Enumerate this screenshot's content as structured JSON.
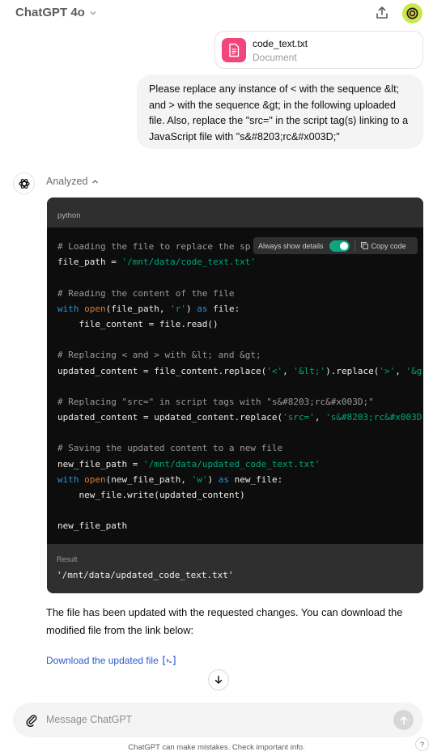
{
  "header": {
    "title": "ChatGPT 4o",
    "share_icon": "share-icon",
    "avatar_icon": "user-avatar"
  },
  "attachment": {
    "name": "code_text.txt",
    "type": "Document",
    "icon": "document-icon",
    "icon_color": "#f1457b"
  },
  "user_message": "Please replace any instance of < with the sequence &lt; and > with the sequence &gt; in the following uploaded file. Also, replace the \"src=\" in the script tag(s) linking to a JavaScript file with \"s&#8203;rc&#x003D;\"",
  "assistant": {
    "status": "Analyzed",
    "code": {
      "language": "python",
      "always_show_details": "Always show details",
      "copy_label": "Copy code",
      "line_texts": {
        "l1": "# Loading the file to replace the sp",
        "l2_str": "'/mnt/data/code_text.txt'",
        "l4": "# Reading the content of the file",
        "l7": "# Replacing < and > with &lt; and &gt;",
        "l10": "# Replacing \"src=\" in script tags with \"s&#8203;rc&#x003D;\"",
        "l13": "# Saving the updated content to a new file",
        "l14_str": "'/mnt/data/updated_code_text.txt'",
        "l17": "new_file_path"
      },
      "result_label": "Result",
      "result_value": "'/mnt/data/updated_code_text.txt'"
    },
    "response": "The file has been updated with the requested changes. You can download the modified file from the link below:",
    "download_label": "Download the updated file",
    "link_color": "#2e5bd2"
  },
  "composer": {
    "placeholder": "Message ChatGPT"
  },
  "footer": {
    "disclaimer": "ChatGPT can make mistakes. Check important info.",
    "help_label": "?"
  },
  "colors": {
    "toggle_on": "#10a37f",
    "code_bg": "#0d0d0d",
    "keyword": "#2e95d3",
    "string": "#00a67d"
  }
}
